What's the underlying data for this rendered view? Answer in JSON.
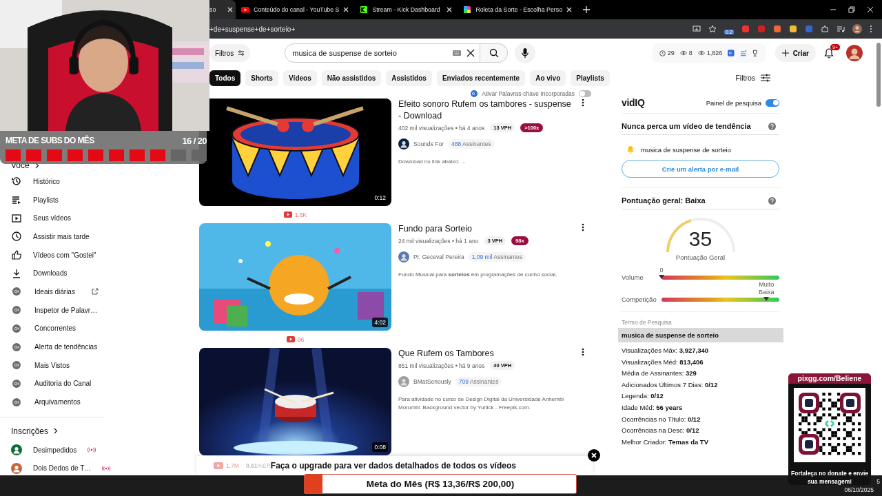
{
  "browser": {
    "tabs": [
      {
        "title": "so",
        "kind": "youtube",
        "selected": true
      },
      {
        "title": "Conteúdo do canal - YouTube S",
        "kind": "youtube",
        "selected": false
      },
      {
        "title": "Stream - Kick Dashboard",
        "kind": "green",
        "selected": false
      },
      {
        "title": "Roleta da Sorte - Escolha Perso",
        "kind": "wheel",
        "selected": false
      }
    ],
    "address": "+de+suspense+de+sorteio+",
    "extension_badge": "0.2"
  },
  "sidebar": {
    "you_heading": "Você",
    "items": [
      {
        "label": "Histórico",
        "kind": "history",
        "external": false
      },
      {
        "label": "Playlists",
        "kind": "playlists",
        "external": false
      },
      {
        "label": "Seus vídeos",
        "kind": "videos",
        "external": false
      },
      {
        "label": "Assistir mais tarde",
        "kind": "later",
        "external": false
      },
      {
        "label": "Vídeos com \"Gostei\"",
        "kind": "liked",
        "external": false
      },
      {
        "label": "Downloads",
        "kind": "downloads",
        "external": false
      },
      {
        "label": "Ideais diárias",
        "kind": "vidiq",
        "external": true
      },
      {
        "label": "Inspetor de Palavr…",
        "kind": "vidiq",
        "external": false
      },
      {
        "label": "Concorrentes",
        "kind": "vidiq",
        "external": false
      },
      {
        "label": "Alerta de tendências",
        "kind": "vidiq",
        "external": false
      },
      {
        "label": "Mais Vistos",
        "kind": "vidiq",
        "external": false
      },
      {
        "label": "Auditoria do Canal",
        "kind": "vidiq",
        "external": false
      },
      {
        "label": "Arquivamentos",
        "kind": "vidiq",
        "external": false
      }
    ],
    "subs_heading": "Inscrições",
    "subscriptions": [
      {
        "name": "Desimpedidos",
        "live": true,
        "color": "#0b6b3a"
      },
      {
        "name": "Dois Dedos de T…",
        "live": true,
        "color": "#c8643c"
      }
    ]
  },
  "header": {
    "filters": "Filtros",
    "search": "musica de suspense de sorteio",
    "stats": [
      {
        "kind": "clock",
        "value": "29"
      },
      {
        "kind": "eye",
        "value": "8"
      },
      {
        "kind": "eye",
        "value": "1,826"
      }
    ],
    "create": "Criar",
    "notifications": "9+"
  },
  "chips": [
    {
      "label": "Todos",
      "selected": true
    },
    {
      "label": "Shorts",
      "selected": false
    },
    {
      "label": "Vídeos",
      "selected": false
    },
    {
      "label": "Não assistidos",
      "selected": false
    },
    {
      "label": "Assistidos",
      "selected": false
    },
    {
      "label": "Enviados recentemente",
      "selected": false
    },
    {
      "label": "Ao vivo",
      "selected": false
    },
    {
      "label": "Playlists",
      "selected": false
    }
  ],
  "filter_button": "Filtros",
  "results": {
    "keyword_toggle": {
      "label": "Ativar Palavras-chave Incorporadas",
      "on": false
    },
    "videos": [
      {
        "title": "Efeito sonoro Rufem os tambores - suspense - Download",
        "meta": "402 mil visualizações • há 4 anos",
        "vph": "13 VPH",
        "outlier": ">100x",
        "channel": "Sounds For",
        "subscribers": "488",
        "subscribers_label": "Assinantes",
        "description": "Download no link abaixo: ...",
        "duration": "0:12",
        "stat": "1.6K",
        "kind": "drum"
      },
      {
        "title": "Fundo para Sorteio",
        "meta": "24 mil visualizações • há 1 ano",
        "vph": "3 VPH",
        "outlier": "98x",
        "channel": "Pr. Geceval Pereira",
        "subscribers": "1,09 mil",
        "subscribers_label": "Assinantes",
        "description": "Fundo Musical para **sorteios** em programações de cunho social.",
        "duration": "4:02",
        "stat": "96",
        "kind": "party"
      },
      {
        "title": "Que Rufem os Tambores",
        "meta": "851 mil visualizações • há 9 anos",
        "vph": "40 VPH",
        "channel": "BMatSeriously",
        "subscribers": "709",
        "subscribers_label": "Assinantes",
        "description": "Para atividade no curso de Design Digital da Universidade Anhembi Morumbi. Background vector by Yurlick - Freepik.com.",
        "duration": "0:08",
        "kind": "stage"
      }
    ]
  },
  "vidiq": {
    "logo": "vidIQ",
    "panel_toggle": {
      "label": "Painel de pesquisa",
      "on": true
    },
    "trend": {
      "title": "Nunca perca um vídeo de tendência",
      "keyword": "musica de suspense de sorteio",
      "button": "Crie um alerta por e-mail"
    },
    "score": {
      "title": "Pontuação geral: Baixa",
      "value": "35",
      "label": "Pontuação Geral",
      "level": 0.35
    },
    "meters": [
      {
        "label": "Volume",
        "marker": "0",
        "level": 0
      },
      {
        "label": "Competição",
        "marker": "Muito Baixa",
        "level": 0.89
      }
    ],
    "term": {
      "label": "Termo de Pesquisa",
      "value": "musica de suspense de sorteio"
    },
    "stats": [
      "Visualizações Máx: **3,927,340**",
      "Visualizações Méd: **813,406**",
      "Média de Assinantes: **329**",
      "Adicionados Últimos 7 Dias: **0/12**",
      "Legenda: **0/12**",
      "Idade Méd: **56 years**",
      "Ocorrências no Título: **0/12**",
      "Ocorrências na Desc: **0/12**",
      "Melhor Criador: **Temas da TV**"
    ]
  },
  "upgrade": {
    "views": "1.7M",
    "engagement": "**0.61**%ER",
    "message": "Faça o upgrade para ver dados detalhados de todos os vídeos"
  },
  "subs_goal": {
    "title": "META DE SUBS DO MÊS",
    "count": "16 / 20",
    "level": 0.8
  },
  "donation": {
    "url": "pixgg.com/Beliene",
    "message": "Fortaleça no donate e envie sua mensagem!"
  },
  "goal_bar": {
    "label": "Meta do Mês (R$ 13,36/R$ 200,00)",
    "level": 0.0668
  },
  "taskbar": {
    "time": "5",
    "date": "06/10/2025"
  }
}
